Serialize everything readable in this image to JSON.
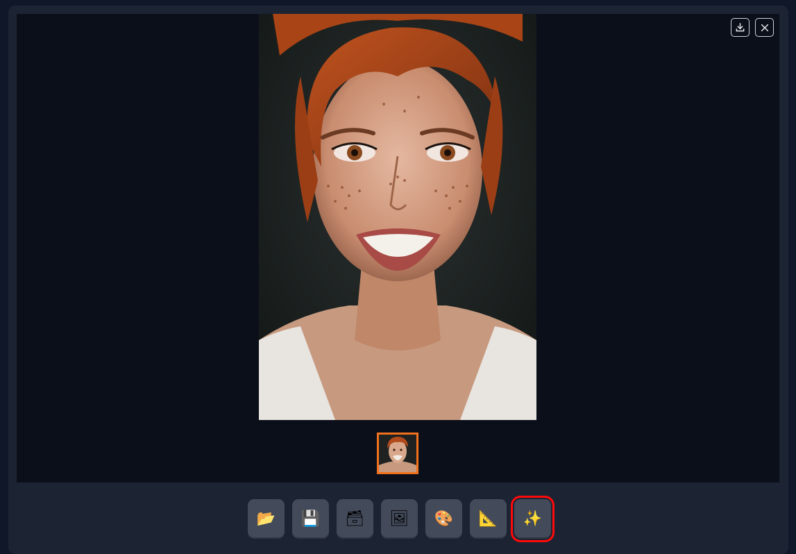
{
  "viewer": {
    "main_image": {
      "subject": "portrait-photo"
    },
    "thumbnails": [
      {
        "selected": true
      }
    ],
    "top_actions": [
      {
        "name": "download",
        "icon": "download-icon"
      },
      {
        "name": "close",
        "icon": "close-icon"
      }
    ]
  },
  "toolbar": {
    "buttons": [
      {
        "name": "open",
        "icon": "folder-icon",
        "glyph": "📂"
      },
      {
        "name": "save",
        "icon": "floppy-disk-icon",
        "glyph": "💾"
      },
      {
        "name": "save-as",
        "icon": "card-file-box-icon",
        "glyph": "🗃"
      },
      {
        "name": "image",
        "icon": "framed-picture-icon",
        "glyph": "🖼"
      },
      {
        "name": "palette",
        "icon": "artist-palette-icon",
        "glyph": "🎨"
      },
      {
        "name": "ruler",
        "icon": "triangular-ruler-icon",
        "glyph": "📐"
      },
      {
        "name": "enhance",
        "icon": "sparkles-icon",
        "glyph": "✨",
        "selected": true
      }
    ]
  },
  "colors": {
    "page_bg": "#0f1729",
    "panel_bg": "#1c2433",
    "viewer_bg": "#0b0f1a",
    "button_bg": "#434b5b",
    "thumb_selected_border": "#f2711c",
    "highlight_border": "#ff0a0a"
  }
}
